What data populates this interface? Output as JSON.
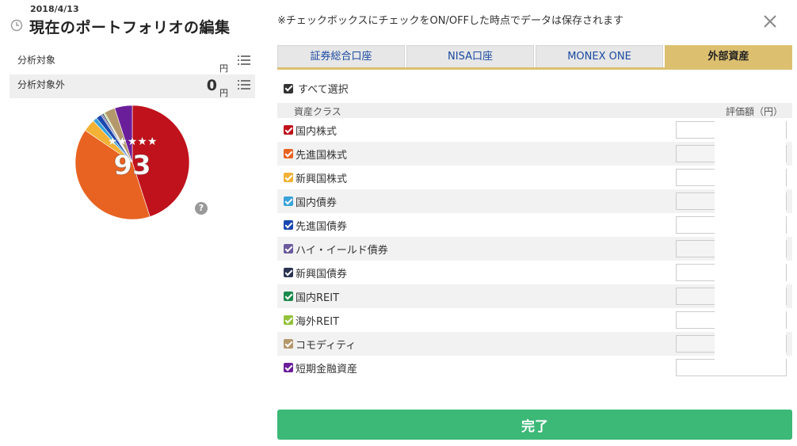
{
  "left": {
    "date": "2018/4/13",
    "title": "現在のポートフォリオの編集",
    "summary": [
      {
        "label": "分析対象",
        "value": "",
        "unit": "円"
      },
      {
        "label": "分析対象外",
        "value": "0",
        "unit": "円"
      }
    ],
    "score": {
      "stars": "★★★★★",
      "value": "93"
    },
    "help": "?",
    "pie": [
      {
        "name": "国内株式",
        "share": 0.45,
        "color": "#c0121c"
      },
      {
        "name": "先進国株式",
        "share": 0.395,
        "color": "#e86322"
      },
      {
        "name": "新興国株式",
        "share": 0.035,
        "color": "#f3b235"
      },
      {
        "name": "国内債券",
        "share": 0.012,
        "color": "#39a3da"
      },
      {
        "name": "先進国債券",
        "share": 0.015,
        "color": "#1a47b0"
      },
      {
        "name": "ハイ・イールド債券",
        "share": 0.004,
        "color": "#6b5a9e"
      },
      {
        "name": "新興国債券",
        "share": 0.004,
        "color": "#2a3352"
      },
      {
        "name": "国内REIT",
        "share": 0.002,
        "color": "#1b8a4c"
      },
      {
        "name": "海外REIT",
        "share": 0.003,
        "color": "#93c23c"
      },
      {
        "name": "コモディティ",
        "share": 0.03,
        "color": "#b4986b"
      },
      {
        "name": "短期金融資産",
        "share": 0.05,
        "color": "#6b1e9a"
      }
    ]
  },
  "notice": "※チェックボックスにチェックをON/OFFした時点でデータは保存されます",
  "tabs": [
    {
      "label": "証券総合口座",
      "active": false
    },
    {
      "label": "NISA口座",
      "active": false
    },
    {
      "label": "MONEX ONE",
      "active": false
    },
    {
      "label": "外部資産",
      "active": true
    }
  ],
  "select_all": "すべて選択",
  "table": {
    "col_class": "資産クラス",
    "col_value": "評価額（円）",
    "rows": [
      {
        "name": "国内株式",
        "color": "#c0121c",
        "value": ""
      },
      {
        "name": "先進国株式",
        "color": "#e86322",
        "value": ""
      },
      {
        "name": "新興国株式",
        "color": "#f3b235",
        "value": ""
      },
      {
        "name": "国内債券",
        "color": "#39a3da",
        "value": ""
      },
      {
        "name": "先進国債券",
        "color": "#1a47b0",
        "value": ""
      },
      {
        "name": "ハイ・イールド債券",
        "color": "#6b5a9e",
        "value": ""
      },
      {
        "name": "新興国債券",
        "color": "#2a3352",
        "value": ""
      },
      {
        "name": "国内REIT",
        "color": "#1b8a4c",
        "value": ""
      },
      {
        "name": "海外REIT",
        "color": "#93c23c",
        "value": ""
      },
      {
        "name": "コモディティ",
        "color": "#b4986b",
        "value": ""
      },
      {
        "name": "短期金融資産",
        "color": "#6b1e9a",
        "value": ""
      }
    ]
  },
  "done_label": "完了",
  "colors": {
    "tab_active": "#dcc070",
    "done": "#3cb877",
    "checkbox_dark": "#333333"
  }
}
